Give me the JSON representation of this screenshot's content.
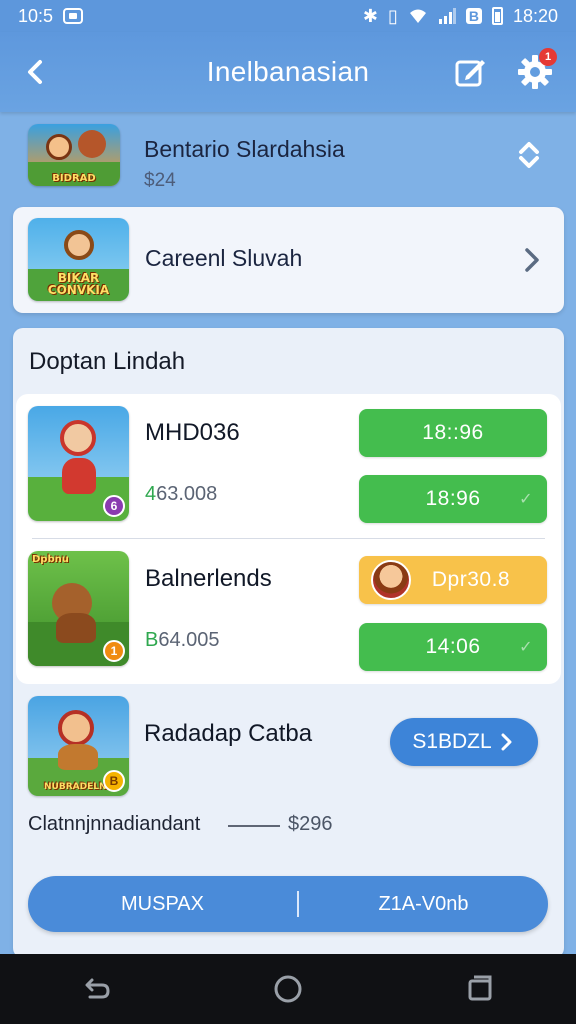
{
  "status_bar": {
    "time_left": "10:5",
    "time_right": "18:20",
    "icons": [
      "notification-icon",
      "bluetooth-icon",
      "vibrate-icon",
      "wifi-icon",
      "signal-icon",
      "data-icon",
      "battery-icon"
    ]
  },
  "app_bar": {
    "title": "Inelbanasian",
    "notification_badge": "1",
    "icons": [
      "back-arrow-icon",
      "edit-icon",
      "gear-icon"
    ]
  },
  "header": {
    "game_name": "Bentario Slardahsia",
    "game_sub": "$24",
    "icon_label": "BIDRAD",
    "icons": [
      "sort-up-down-icon"
    ]
  },
  "current_card": {
    "label": "Careenl Sluvah",
    "icon_label": "BIKAR CONVKIA",
    "icons": [
      "chevron-right-icon"
    ]
  },
  "panel": {
    "title": "Doptan Lindah",
    "items": [
      {
        "name": "MHD036",
        "price_prefix": "4",
        "price_rest": "63.008",
        "coin": "6",
        "buttons": [
          {
            "label": "18::96",
            "color": "green"
          },
          {
            "label": "18:96",
            "color": "green",
            "check": "✓"
          }
        ]
      },
      {
        "name": "Balnerlends",
        "price_prefix": "B",
        "price_rest": "64.005",
        "coin": "1",
        "icon_label": "Dpbnu",
        "buttons": [
          {
            "label": "Dpr30.8",
            "color": "orange"
          },
          {
            "label": "14:06",
            "color": "green",
            "check": "✓"
          }
        ]
      },
      {
        "name": "Radadap Catba",
        "icon_label": "NUBRADELNS",
        "coin": "B",
        "button": "S1BDZL"
      }
    ]
  },
  "total": {
    "label": "Clatnnjnnadiandant",
    "amount": "$296"
  },
  "bottom_bar": {
    "left": "MUSPAX",
    "right": "Z1A-V0nb"
  },
  "nav": {
    "icons": [
      "back-nav-icon",
      "home-nav-icon",
      "recents-nav-icon"
    ]
  },
  "colors": {
    "app_bar": "#5e98dd",
    "green_button": "#44bd4e",
    "orange_button": "#f8c24a",
    "blue_button": "#3d84d8"
  }
}
